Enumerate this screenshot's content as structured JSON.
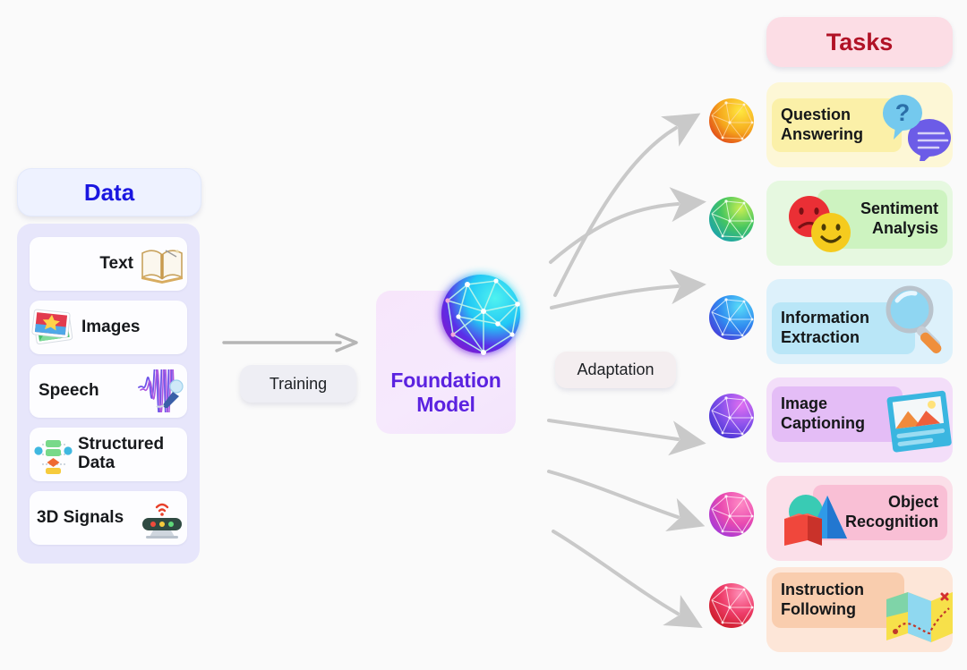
{
  "background": "#fafafa",
  "left_column": {
    "header": {
      "label": "Data",
      "bg": "#eef2ff",
      "color": "#1a16e0"
    },
    "panel_bg": "#e7e6fb",
    "items": [
      {
        "label": "Text",
        "icon": "open-book-icon",
        "order": "label-then-icon"
      },
      {
        "label": "Images",
        "icon": "photos-icon",
        "order": "icon-then-label"
      },
      {
        "label": "Speech",
        "icon": "microphone-wave-icon",
        "order": "label-then-icon"
      },
      {
        "label": "Structured\nData",
        "icon": "flowchart-icon",
        "order": "icon-then-label"
      },
      {
        "label": "3D Signals",
        "icon": "lidar-sensor-icon",
        "order": "label-then-icon"
      }
    ]
  },
  "training": {
    "label": "Training",
    "bg": "#eeeef4",
    "arrow": "straight-arrow-right"
  },
  "foundation_model": {
    "line1": "Foundation",
    "line2": "Model",
    "bg": "#f5e7fc",
    "color": "#5b22e0",
    "icon": "network-sphere-icon"
  },
  "adaptation": {
    "label": "Adaptation",
    "bg": "#f4eef0"
  },
  "right_column": {
    "header": {
      "label": "Tasks",
      "bg": "#fcdde5",
      "color": "#b11226"
    },
    "tasks": [
      {
        "label": "Question\nAnswering",
        "outer_bg": "#fdf7d6",
        "inner_bg": "#fbf0a8",
        "align": "left",
        "art": "speech-bubbles-icon",
        "sphere": "sphere-yellow-red",
        "sphere_from": "#f7d417",
        "sphere_to": "#e0401f"
      },
      {
        "label": "Sentiment\nAnalysis",
        "outer_bg": "#e6f8e0",
        "inner_bg": "#cdf3c0",
        "align": "right",
        "art": "emoji-faces-icon",
        "sphere": "sphere-green-teal",
        "sphere_from": "#a6e047",
        "sphere_to": "#1ba0a8"
      },
      {
        "label": "Information\nExtraction",
        "outer_bg": "#ddf1fb",
        "inner_bg": "#b9e6f7",
        "align": "left",
        "art": "magnifier-icon",
        "sphere": "sphere-cyan-blue",
        "sphere_from": "#34c6f4",
        "sphere_to": "#4b36d8"
      },
      {
        "label": "Image\nCaptioning",
        "outer_bg": "#f3def9",
        "inner_bg": "#e4bdf6",
        "align": "left",
        "art": "picture-card-icon",
        "sphere": "sphere-violet-magenta",
        "sphere_from": "#c05ae8",
        "sphere_to": "#3f35d6"
      },
      {
        "label": "Object\nRecognition",
        "outer_bg": "#fbdfe9",
        "inner_bg": "#f9bfd5",
        "align": "right",
        "art": "shapes-icon",
        "sphere": "sphere-pink-magenta",
        "sphere_from": "#ef5fb0",
        "sphere_to": "#a23ae0"
      },
      {
        "label": "Instruction\nFollowing",
        "outer_bg": "#fde6d8",
        "inner_bg": "#f9cdae",
        "align": "left",
        "art": "map-route-icon",
        "sphere": "sphere-red-pink",
        "sphere_from": "#f06aa0",
        "sphere_to": "#d8202c"
      }
    ]
  },
  "connectors": {
    "count": 6,
    "color": "#c9c9c9",
    "style": "curved-arrow"
  }
}
